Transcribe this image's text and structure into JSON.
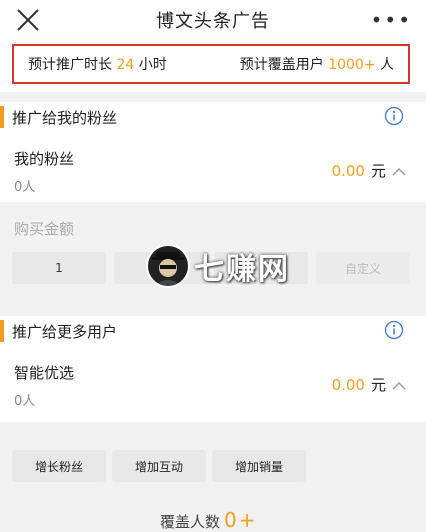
{
  "header": {
    "title": "博文头条广告",
    "more_label": "•••"
  },
  "summary": {
    "duration_prefix": "预计推广时长",
    "duration_value": "24",
    "duration_unit": "小时",
    "reach_prefix": "预计覆盖用户",
    "reach_value": "1000+",
    "reach_unit": "人"
  },
  "section_fans": {
    "title": "推广给我的粉丝",
    "row_title": "我的粉丝",
    "row_sub": "0人",
    "price": "0.00",
    "price_unit": "元"
  },
  "purchase": {
    "label": "购买金额",
    "options": [
      "1",
      "",
      "",
      "自定义"
    ]
  },
  "watermark": {
    "text": "七赚网"
  },
  "section_more": {
    "title": "推广给更多用户",
    "row_title": "智能优选",
    "row_sub": "0人",
    "price": "0.00",
    "price_unit": "元",
    "tags": [
      "增长粉丝",
      "增加互动",
      "增加销量"
    ]
  },
  "cover": {
    "label": "覆盖人数",
    "value": "0",
    "plus": "+"
  },
  "colors": {
    "accent": "#f0a020",
    "highlight_border": "#d9352b",
    "section_bar": "#f59a23"
  },
  "icons": {
    "close": "close-icon",
    "info": "info-icon",
    "chevron": "chevron-up-icon"
  }
}
